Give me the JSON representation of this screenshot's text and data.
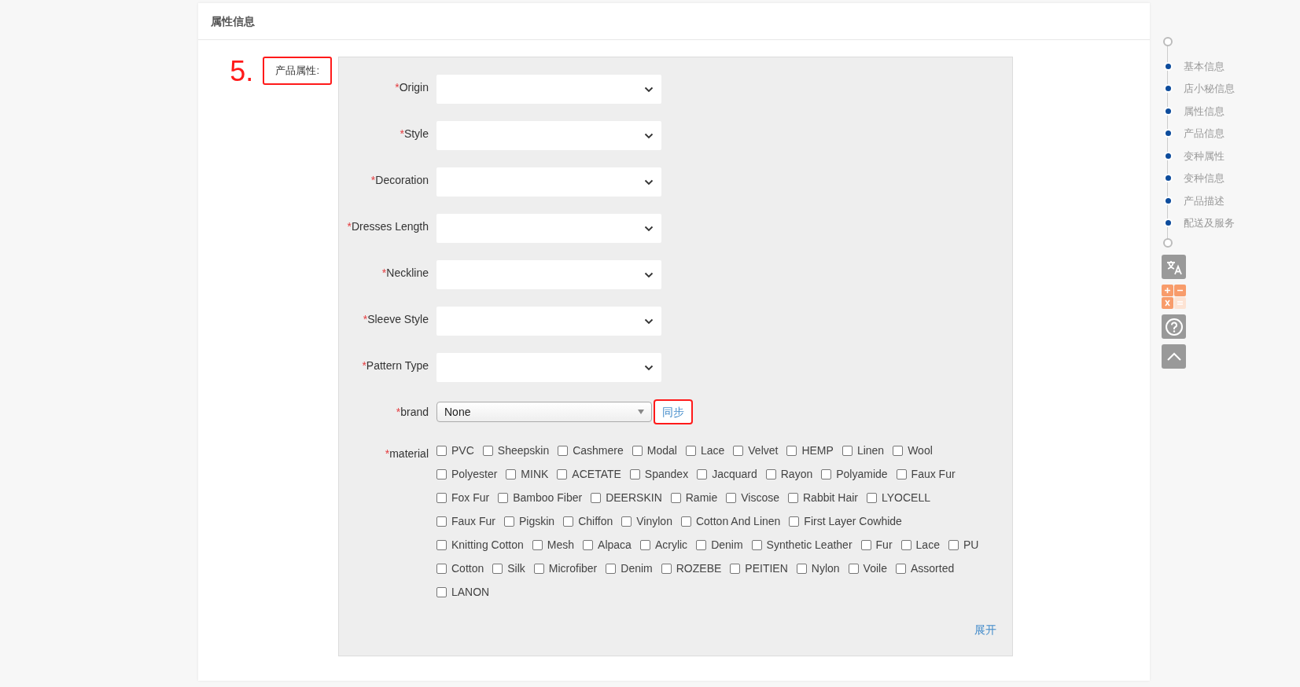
{
  "section": {
    "title": "属性信息"
  },
  "step_marker": "5.",
  "group_label": {
    "text": "产品属性:",
    "highlighted": true
  },
  "selects": [
    {
      "required_mark": "*",
      "label": "Origin"
    },
    {
      "required_mark": "*",
      "label": "Style"
    },
    {
      "required_mark": "*",
      "label": "Decoration"
    },
    {
      "required_mark": "*",
      "label": "Dresses Length"
    },
    {
      "required_mark": "*",
      "label": "Neckline"
    },
    {
      "required_mark": "*",
      "label": "Sleeve Style"
    },
    {
      "required_mark": "*",
      "label": "Pattern Type"
    }
  ],
  "brand": {
    "required_mark": "*",
    "label": "brand",
    "value": "None",
    "sync_button": {
      "text": "同步",
      "highlighted": true
    }
  },
  "material": {
    "required_mark": "*",
    "label": "material",
    "options": [
      {
        "text": "PVC",
        "checked": false
      },
      {
        "text": "Sheepskin",
        "checked": false
      },
      {
        "text": "Cashmere",
        "checked": false
      },
      {
        "text": "Modal",
        "checked": false
      },
      {
        "text": "Lace",
        "checked": false
      },
      {
        "text": "Velvet",
        "checked": false
      },
      {
        "text": "HEMP",
        "checked": false
      },
      {
        "text": "Linen",
        "checked": false
      },
      {
        "text": "Wool",
        "checked": false
      },
      {
        "text": "Polyester",
        "checked": false
      },
      {
        "text": "MINK",
        "checked": false
      },
      {
        "text": "ACETATE",
        "checked": false
      },
      {
        "text": "Spandex",
        "checked": false
      },
      {
        "text": "Jacquard",
        "checked": false
      },
      {
        "text": "Rayon",
        "checked": false
      },
      {
        "text": "Polyamide",
        "checked": false
      },
      {
        "text": "Faux Fur",
        "checked": false
      },
      {
        "text": "Fox Fur",
        "checked": false
      },
      {
        "text": "Bamboo Fiber",
        "checked": false
      },
      {
        "text": "DEERSKIN",
        "checked": false
      },
      {
        "text": "Ramie",
        "checked": false
      },
      {
        "text": "Viscose",
        "checked": false
      },
      {
        "text": "Rabbit Hair",
        "checked": false
      },
      {
        "text": "LYOCELL",
        "checked": false
      },
      {
        "text": "Faux Fur",
        "checked": false
      },
      {
        "text": "Pigskin",
        "checked": false
      },
      {
        "text": "Chiffon",
        "checked": false
      },
      {
        "text": "Vinylon",
        "checked": false
      },
      {
        "text": "Cotton And Linen",
        "checked": false
      },
      {
        "text": "First Layer Cowhide",
        "checked": false
      },
      {
        "text": "Knitting Cotton",
        "checked": false
      },
      {
        "text": "Mesh",
        "checked": false
      },
      {
        "text": "Alpaca",
        "checked": false
      },
      {
        "text": "Acrylic",
        "checked": false
      },
      {
        "text": "Denim",
        "checked": false
      },
      {
        "text": "Synthetic Leather",
        "checked": false
      },
      {
        "text": "Fur",
        "checked": false
      },
      {
        "text": "Lace",
        "checked": false
      },
      {
        "text": "PU",
        "checked": false
      },
      {
        "text": "Cotton",
        "checked": false
      },
      {
        "text": "Silk",
        "checked": false
      },
      {
        "text": "Microfiber",
        "checked": false
      },
      {
        "text": "Denim",
        "checked": false
      },
      {
        "text": "ROZEBE",
        "checked": false
      },
      {
        "text": "PEITIEN",
        "checked": false
      },
      {
        "text": "Nylon",
        "checked": false
      },
      {
        "text": "Voile",
        "checked": false
      },
      {
        "text": "Assorted",
        "checked": false
      },
      {
        "text": "LANON",
        "checked": false
      }
    ]
  },
  "expand_link": "展开",
  "nav": {
    "items": [
      "基本信息",
      "店小秘信息",
      "属性信息",
      "产品信息",
      "变种属性",
      "变种信息",
      "产品描述",
      "配送及服务"
    ]
  },
  "tools": [
    {
      "kind": "translate"
    },
    {
      "kind": "calculator"
    },
    {
      "kind": "help"
    },
    {
      "kind": "top"
    }
  ]
}
